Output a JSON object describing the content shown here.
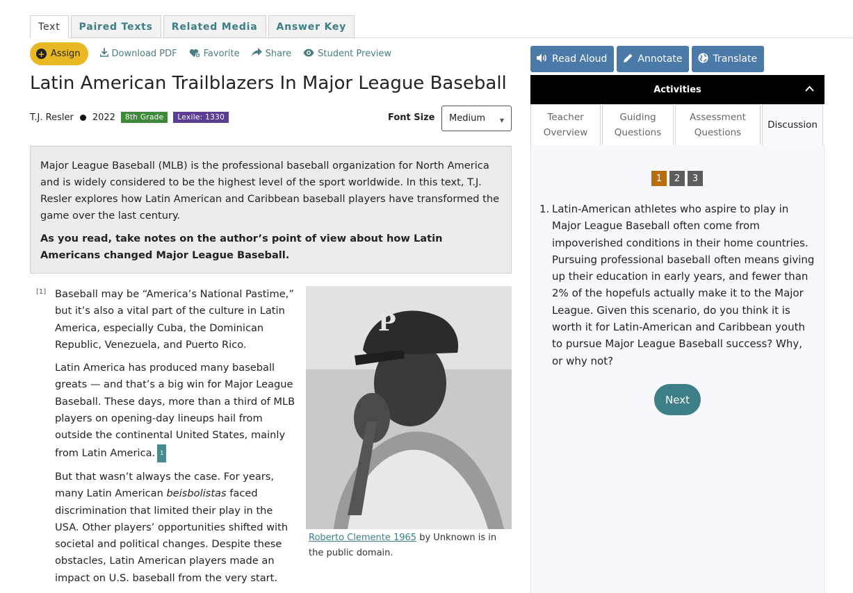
{
  "tabs": [
    "Text",
    "Paired Texts",
    "Related Media",
    "Answer Key"
  ],
  "actions": {
    "assign": "Assign",
    "download": "Download PDF",
    "favorite": "Favorite",
    "share": "Share",
    "preview": "Student Preview"
  },
  "article": {
    "title": "Latin American Trailblazers In Major League Baseball",
    "author": "T.J. Resler",
    "year": "2022",
    "grade": "8th Grade",
    "lexile": "Lexile: 1330",
    "font_size_label": "Font Size",
    "font_size_value": "Medium",
    "intro": "Major League Baseball (MLB) is the professional baseball organization for North America and is widely considered to be the highest level of the sport worldwide. In this text, T.J. Resler explores how Latin American and Caribbean baseball players have transformed the game over the last century.",
    "intro_prompt": "As you read, take notes on the author’s point of view about how Latin Americans changed Major League Baseball.",
    "paragraph_number": "[1]",
    "p1": "Baseball may be “America’s National Pastime,” but it’s also a vital part of the culture in Latin America, especially Cuba, the Dominican Republic, Venezuela, and Puerto Rico.",
    "p2": "Latin America has produced many baseball greats — and that’s a big win for Major League Baseball. These days, more than a third of MLB players on opening-day lineups hail from outside the continental United States, mainly from Latin America.",
    "footnote": "1",
    "p3_before": "But that wasn’t always the case. For years, many Latin American ",
    "p3_italic": "beisbolistas",
    "p3_after": " faced discrimination that limited their play in the USA. Other players’ opportunities shifted with societal and political changes. Despite these obstacles, Latin American players made an impact on U.S. baseball from the very start.",
    "caption_link": "Roberto Clemente 1965",
    "caption_rest": " by Unknown is in the public domain."
  },
  "tools": {
    "read_aloud": "Read Aloud",
    "annotate": "Annotate",
    "translate": "Translate"
  },
  "activities": {
    "header": "Activities",
    "tabs": [
      "Teacher Overview",
      "Guiding Questions",
      "Assessment Questions",
      "Discussion"
    ],
    "pages": [
      "1",
      "2",
      "3"
    ],
    "question_number": "1.",
    "question": "Latin-American athletes who aspire to play in Major League Baseball often come from impoverished conditions in their home countries. Pursuing professional baseball often means giving up their education in early years, and fewer than 2% of the hopefuls actually make it to the Major League. Given this scenario, do you think it is worth it for Latin-American and Caribbean youth to pursue Major League Baseball success? Why, or why not?",
    "next": "Next"
  },
  "colors": {
    "accent_teal": "#3d7d86",
    "assign_yellow": "#e8b923",
    "tool_blue": "#4b79a8",
    "grade_green": "#3f8a3a",
    "lexile_purple": "#5b3e91",
    "page_active": "#b86e0f"
  },
  "icons": [
    "plus-circle-icon",
    "download-icon",
    "favorite-icon",
    "share-icon",
    "eye-icon",
    "speaker-icon",
    "pencil-icon",
    "globe-icon",
    "chevron-up-icon",
    "caret-down-icon"
  ]
}
